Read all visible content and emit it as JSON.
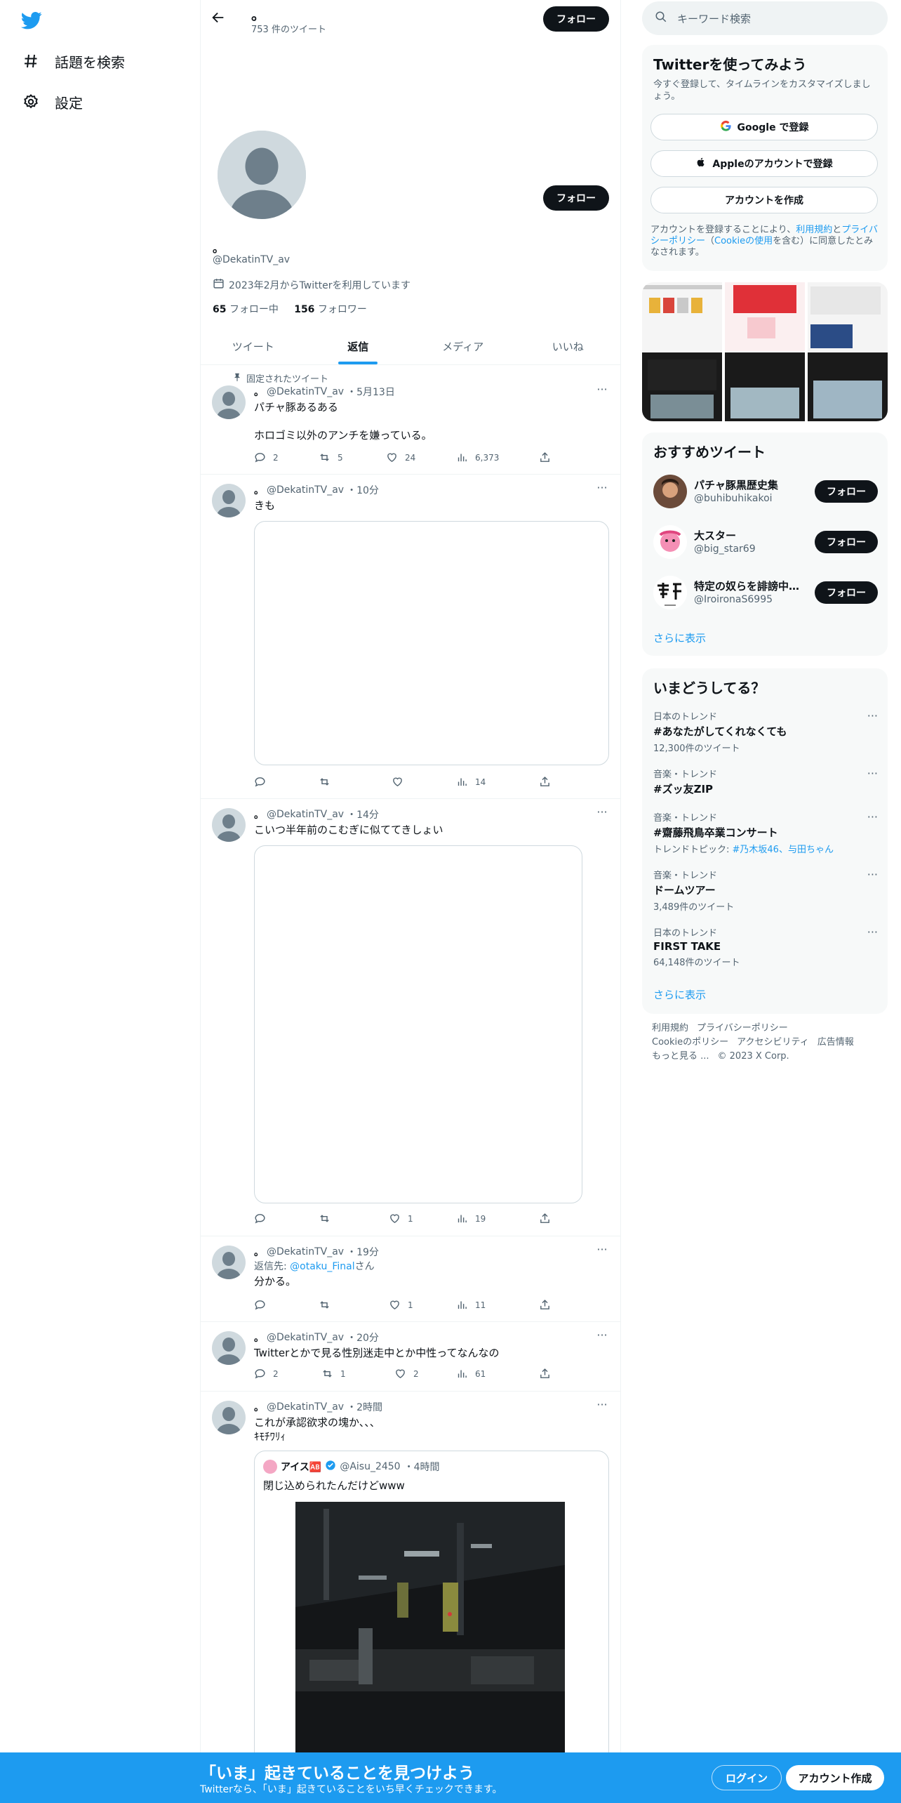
{
  "nav": {
    "explore_label": "話題を検索",
    "settings_label": "設定"
  },
  "profile": {
    "title": "。",
    "tweet_count": "753 件のツイート",
    "follow_label": "フォロー",
    "display_name": "。",
    "handle": "@DekatinTV_av",
    "joined": "2023年2月からTwitterを利用しています",
    "following_count": "65",
    "following_label": "フォロー中",
    "followers_count": "156",
    "followers_label": "フォロワー",
    "tabs": [
      "ツイート",
      "返信",
      "メディア",
      "いいね"
    ]
  },
  "tweets": [
    {
      "pinned_label": "固定されたツイート",
      "name": "。",
      "handle": "@DekatinTV_av",
      "time": "・5月13日",
      "text": "パチャ豚あるある\n\nホロゴミ以外のアンチを嫌っている。",
      "replies": "2",
      "retweets": "5",
      "likes": "24",
      "views": "6,373"
    },
    {
      "name": "。",
      "handle": "@DekatinTV_av",
      "time": "・10分",
      "text": "きも",
      "replies": "",
      "retweets": "",
      "likes": "",
      "views": "14"
    },
    {
      "name": "。",
      "handle": "@DekatinTV_av",
      "time": "・14分",
      "text": "こいつ半年前のこむぎに似ててきしょい",
      "replies": "",
      "retweets": "",
      "likes": "1",
      "views": "19"
    },
    {
      "name": "。",
      "handle": "@DekatinTV_av",
      "time": "・19分",
      "reply_prefix": "返信先: ",
      "reply_to": "@otaku_Final",
      "reply_suffix": "さん",
      "text": "分かる。",
      "replies": "",
      "retweets": "",
      "likes": "1",
      "views": "11"
    },
    {
      "name": "。",
      "handle": "@DekatinTV_av",
      "time": "・20分",
      "text": "Twitterとかで見る性別迷走中とか中性ってなんなの",
      "replies": "2",
      "retweets": "1",
      "likes": "2",
      "views": "61"
    },
    {
      "name": "。",
      "handle": "@DekatinTV_av",
      "time": "・2時間",
      "text": "これが承認欲求の塊か、、、\nｷﾓﾁﾜﾘｨ",
      "quote": {
        "name": "アイス🆎",
        "handle": "@Aisu_2450",
        "time": "・4時間",
        "text": "閉じ込められたんだけどwww"
      }
    }
  ],
  "right": {
    "search_placeholder": "キーワード検索",
    "signup_card": {
      "title": "Twitterを使ってみよう",
      "subtitle": "今すぐ登録して、タイムラインをカスタマイズしましょう。",
      "google": "Google で登録",
      "apple": "Appleのアカウントで登録",
      "create": "アカウントを作成",
      "terms_1": "アカウントを登録することにより、",
      "terms_link1": "利用規約",
      "terms_2": "と",
      "terms_link2": "プライバシーポリシー",
      "terms_3": "（",
      "terms_link3": "Cookieの使用",
      "terms_4": "を含む）に同意したとみなされます。"
    },
    "recommend": {
      "title": "おすすめツイート",
      "items": [
        {
          "name": "パチャ豚黒歴史集",
          "handle": "@buhibuhikakoi",
          "btn": "フォロー"
        },
        {
          "name": "大スター",
          "handle": "@big_star69",
          "btn": "フォロー"
        },
        {
          "name": "特定の奴らを誹謗中傷する垢",
          "handle": "@IroironaS6995",
          "btn": "フォロー"
        }
      ],
      "more": "さらに表示"
    },
    "trends": {
      "title": "いまどうしてる？",
      "items": [
        {
          "cat": "日本のトレンド",
          "name": "#あなたがしてくれなくても",
          "sub": "12,300件のツイート"
        },
        {
          "cat": "音楽・トレンド",
          "name": "#ズッ友ZIP",
          "sub": ""
        },
        {
          "cat": "音楽・トレンド",
          "name": "#齋藤飛鳥卒業コンサート",
          "sub_prefix": "トレンドトピック: ",
          "sub_link": "#乃木坂46、与田ちゃん"
        },
        {
          "cat": "音楽・トレンド",
          "name": "ドームツアー",
          "sub": "3,489件のツイート"
        },
        {
          "cat": "日本のトレンド",
          "name": "FIRST TAKE",
          "sub": "64,148件のツイート"
        }
      ],
      "more": "さらに表示"
    },
    "footer": {
      "terms": "利用規約",
      "privacy": "プライバシーポリシー",
      "cookie": "Cookieのポリシー",
      "accessibility": "アクセシビリティ",
      "ads": "広告情報",
      "more": "もっと見る ...",
      "copyright": "© 2023 X Corp."
    }
  },
  "bottombar": {
    "headline": "「いま」起きていることを見つけよう",
    "sub": "Twitterなら、「いま」起きていることをいち早くチェックできます。",
    "login": "ログイン",
    "signup": "アカウント作成"
  },
  "colors": {
    "accent": "#1d9bf0",
    "text": "#0f1419",
    "muted": "#536471"
  }
}
